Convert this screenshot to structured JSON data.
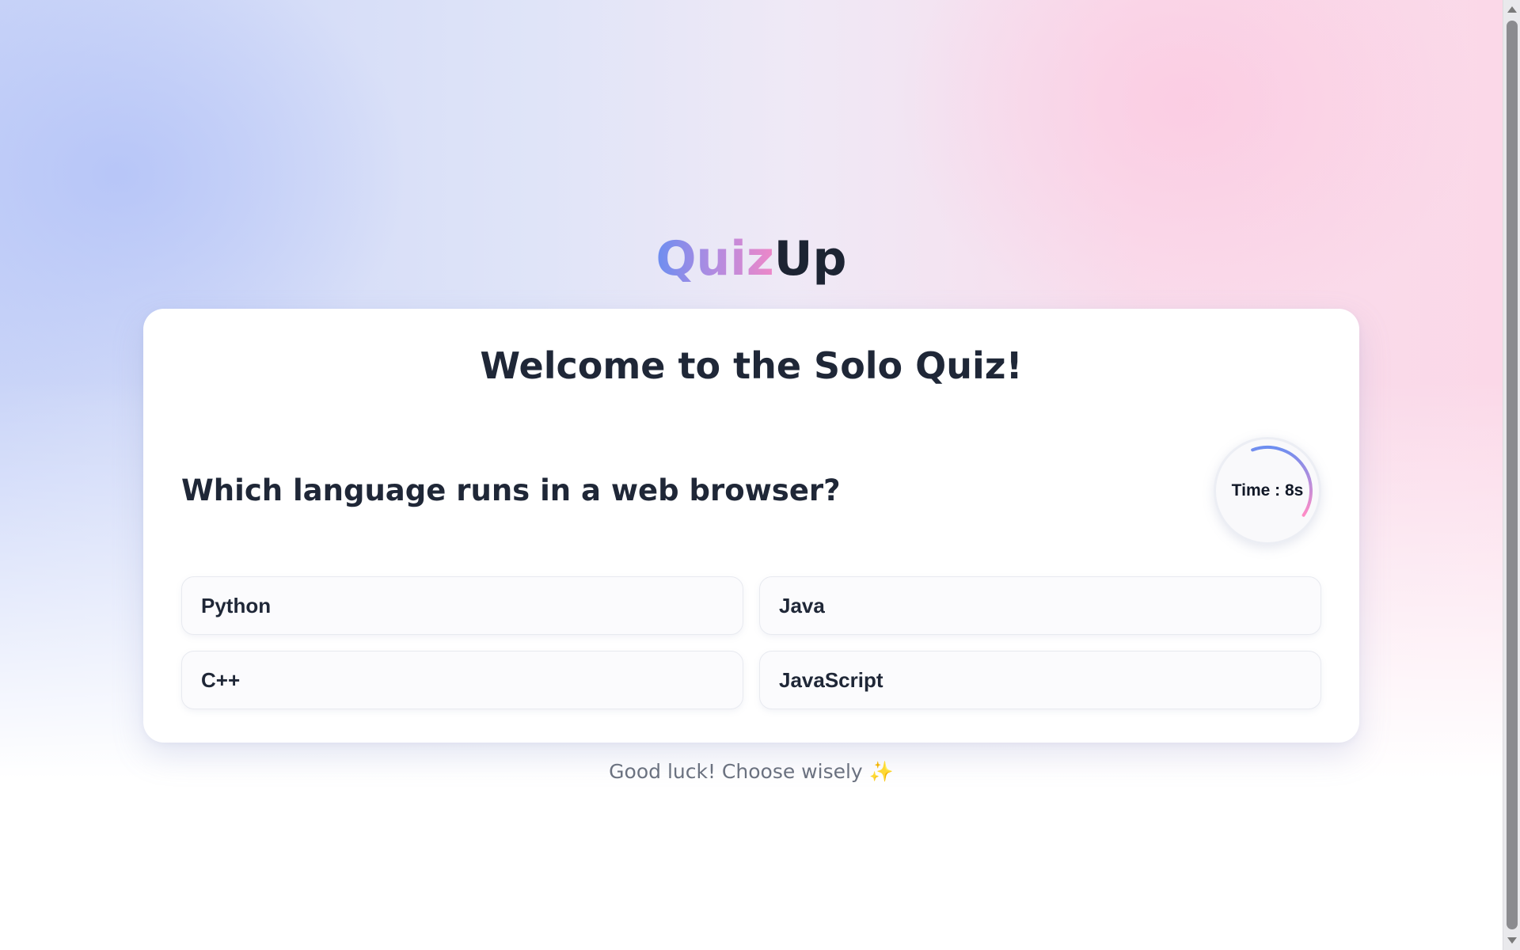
{
  "app": {
    "logo_part1": "Quiz",
    "logo_part2": "Up"
  },
  "card": {
    "title": "Welcome to the Solo Quiz!",
    "question": "Which language runs in a web browser?",
    "timer": {
      "label": "Time : 8s",
      "remaining_fraction": 0.4
    },
    "answers": [
      "Python",
      "Java",
      "C++",
      "JavaScript"
    ]
  },
  "footer": {
    "text": "Good luck! Choose wisely",
    "emoji": "✨"
  },
  "colors": {
    "logo_gradient_start": "#6d8ef0",
    "logo_gradient_end": "#ee88c8",
    "timer_arc_start": "#6d8ef0",
    "timer_arc_end": "#ff8cc6",
    "text_dark": "#1f2737"
  }
}
